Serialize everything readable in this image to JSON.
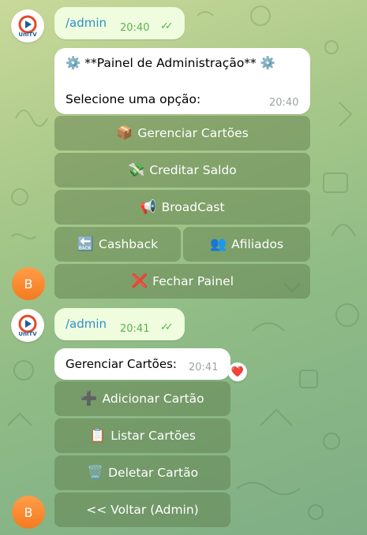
{
  "bot": {
    "logo_text": "UniTV"
  },
  "user": {
    "initial": "B"
  },
  "msg1": {
    "command": "/admin",
    "time": "20:40",
    "status_icon": "double-check"
  },
  "panel": {
    "line1": "⚙️ **Painel de Administração** ⚙️",
    "line2": "Selecione uma opção:",
    "time": "20:40",
    "buttons": {
      "gerenciar": {
        "emoji": "📦",
        "label": "Gerenciar Cartões"
      },
      "creditar": {
        "emoji": "💸",
        "label": "Creditar Saldo"
      },
      "broadcast": {
        "emoji": "📢",
        "label": "BroadCast"
      },
      "cashback": {
        "emoji": "🔙",
        "label": "Cashback"
      },
      "afiliados": {
        "emoji": "👥",
        "label": "Afiliados"
      },
      "fechar": {
        "emoji": "❌",
        "label": "Fechar Painel"
      }
    }
  },
  "msg2": {
    "command": "/admin",
    "time": "20:41",
    "status_icon": "double-check"
  },
  "cards": {
    "text": "Gerenciar Cartões:",
    "time": "20:41",
    "reaction": "❤️",
    "buttons": {
      "adicionar": {
        "emoji": "➕",
        "label": "Adicionar Cartão"
      },
      "listar": {
        "emoji": "📋",
        "label": "Listar Cartões"
      },
      "deletar": {
        "emoji": "🗑️",
        "label": "Deletar Cartão"
      },
      "voltar": {
        "label": "<< Voltar (Admin)"
      }
    }
  }
}
